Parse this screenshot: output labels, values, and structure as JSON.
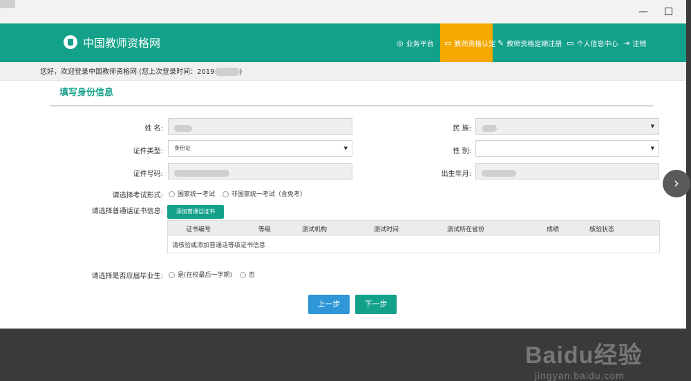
{
  "window": {
    "minimize_glyph": "—"
  },
  "brand": {
    "title": "中国教师资格网"
  },
  "nav": [
    {
      "icon": "◎",
      "label": "业务平台",
      "active": false
    },
    {
      "icon": "▭",
      "label": "教师资格认定",
      "active": true
    },
    {
      "icon": "✎",
      "label": "教师资格定期注册",
      "active": false
    },
    {
      "icon": "▭",
      "label": "个人信息中心",
      "active": false
    },
    {
      "icon": "⇥",
      "label": "注销",
      "active": false
    }
  ],
  "welcome": {
    "text_prefix": "您好，欢迎登录中国教师资格网 (您上次登录时间：2019",
    "text_suffix": ")"
  },
  "section": {
    "title": "填写身份信息"
  },
  "form": {
    "name_label": "姓  名:",
    "id_type_label": "证件类型:",
    "id_type_value": "身份证",
    "id_number_label": "证件号码:",
    "ethnicity_label": "民  族:",
    "gender_label": "性  别:",
    "birth_label": "出生年月:",
    "exam_label": "请选择考试形式:",
    "exam_opt1": "国家统一考试",
    "exam_opt2": "非国家统一考试（含免考）",
    "cert_label": "请选择普通话证书信息:",
    "add_cert_button": "添加普通话证书",
    "graduate_label": "请选择是否应届毕业生:",
    "grad_opt1": "是(在校最后一学期)",
    "grad_opt2": "否"
  },
  "table": {
    "headers": [
      "证书编号",
      "等级",
      "测试机构",
      "测试时间",
      "测试所在省份",
      "成绩",
      "核验状态"
    ],
    "empty_text": "请核验或添加普通话等级证书信息"
  },
  "buttons": {
    "prev": "上一步",
    "next": "下一步"
  },
  "side": {
    "arrow": "›"
  },
  "watermark": {
    "logo": "Baidu经验",
    "url": "jingyan.baidu.com"
  },
  "colors": {
    "primary": "#14a18a",
    "active_tab": "#f5a800",
    "prev_button": "#2f96d8"
  }
}
